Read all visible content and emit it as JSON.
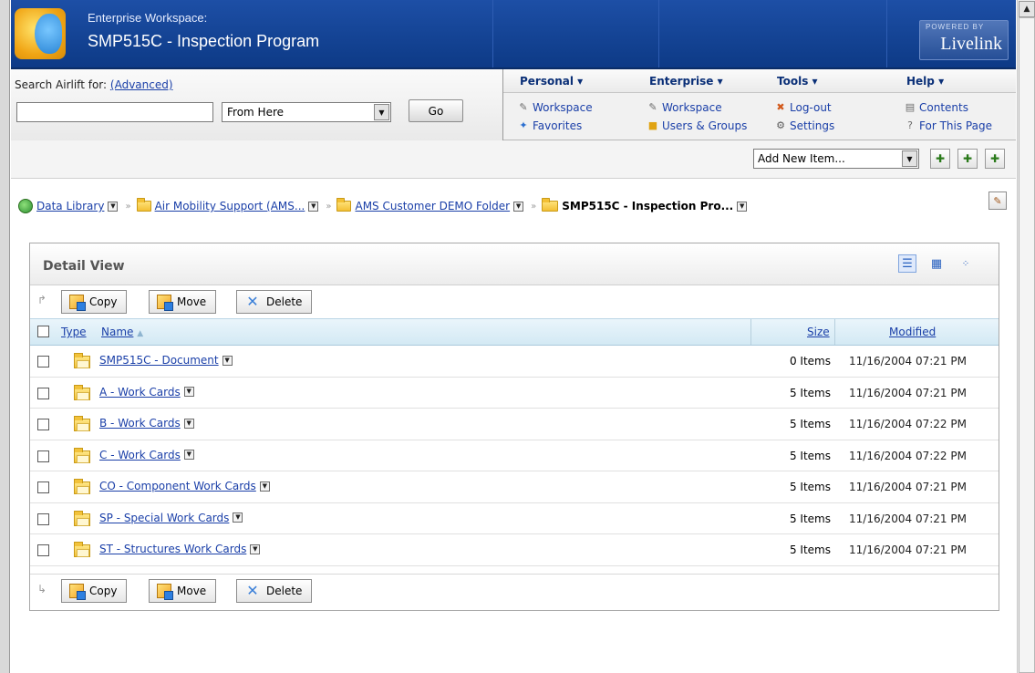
{
  "banner": {
    "subtitle": "Enterprise Workspace:",
    "title": "SMP515C - Inspection Program",
    "powered_top": "POWERED BY",
    "powered_brand": "Livelink"
  },
  "search": {
    "label": "Search Airlift for:",
    "advanced_link": "(Advanced)",
    "input_value": "",
    "scope_value": "From Here",
    "go_label": "Go"
  },
  "menus": {
    "personal": {
      "head": "Personal ▾",
      "items": [
        "Workspace",
        "Favorites"
      ]
    },
    "enterprise": {
      "head": "Enterprise ▾",
      "items": [
        "Workspace",
        "Users & Groups"
      ]
    },
    "tools": {
      "head": "Tools ▾",
      "items": [
        "Log-out",
        "Settings"
      ]
    },
    "help": {
      "head": "Help ▾",
      "items": [
        "Contents",
        "For This Page"
      ]
    }
  },
  "toolbar": {
    "add_new_item": "Add New Item..."
  },
  "breadcrumb": {
    "items": [
      "Data Library",
      "Air Mobility Support (AMS...",
      "AMS Customer DEMO Folder"
    ],
    "current": "SMP515C - Inspection Pro..."
  },
  "detail": {
    "title": "Detail View",
    "actions": {
      "copy": "Copy",
      "move": "Move",
      "delete": "Delete"
    },
    "columns": {
      "type": "Type",
      "name": "Name",
      "size": "Size",
      "modified": "Modified"
    },
    "rows": [
      {
        "name": "SMP515C - Document",
        "size": "0 Items",
        "modified": "11/16/2004 07:21 PM"
      },
      {
        "name": "A - Work Cards",
        "size": "5 Items",
        "modified": "11/16/2004 07:21 PM"
      },
      {
        "name": "B - Work Cards",
        "size": "5 Items",
        "modified": "11/16/2004 07:22 PM"
      },
      {
        "name": "C - Work Cards",
        "size": "5 Items",
        "modified": "11/16/2004 07:22 PM"
      },
      {
        "name": "CO - Component Work Cards",
        "size": "5 Items",
        "modified": "11/16/2004 07:21 PM"
      },
      {
        "name": "SP - Special Work Cards",
        "size": "5 Items",
        "modified": "11/16/2004 07:21 PM"
      },
      {
        "name": "ST - Structures Work Cards",
        "size": "5 Items",
        "modified": "11/16/2004 07:21 PM"
      }
    ]
  }
}
